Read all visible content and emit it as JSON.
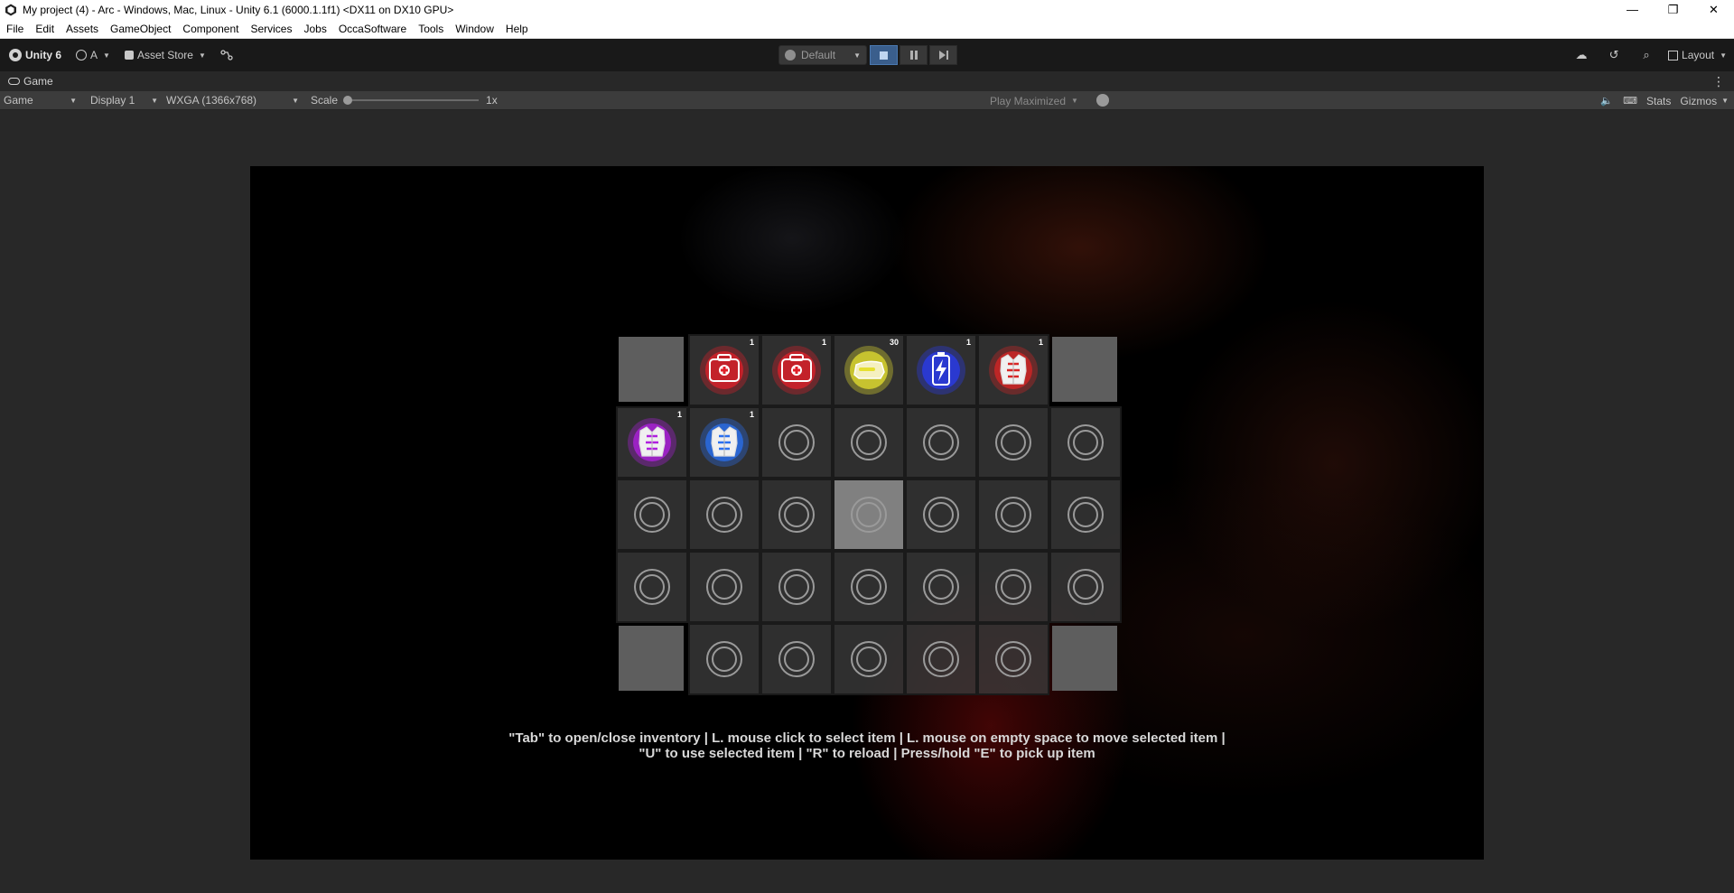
{
  "window": {
    "title": "My project (4) - Arc - Windows, Mac, Linux - Unity 6.1 (6000.1.1f1) <DX11 on DX10 GPU>",
    "minimize": "—",
    "maximize": "❐",
    "close": "✕"
  },
  "menu": [
    "File",
    "Edit",
    "Assets",
    "GameObject",
    "Component",
    "Services",
    "Jobs",
    "OccaSoftware",
    "Tools",
    "Window",
    "Help"
  ],
  "toolbar": {
    "unity_label": "Unity 6",
    "account_label": "A",
    "asset_store_label": "Asset Store",
    "layers_label": "Default",
    "layout_label": "Layout",
    "play_active_color": "#3a5e8c"
  },
  "game_tab": {
    "label": "Game",
    "menu": "⋮"
  },
  "game_bar": {
    "mode": "Game",
    "display": "Display 1",
    "resolution": "WXGA (1366x768)",
    "scale_label": "Scale",
    "scale_value": "1x",
    "scale_fraction": 0.0,
    "play_mode": "Play Maximized",
    "stats": "Stats",
    "gizmos": "Gizmos"
  },
  "inventory": {
    "slots": [
      {
        "kind": "corner"
      },
      {
        "kind": "item",
        "icon": "medkit-icon",
        "qty": "1",
        "color": "#e0202a"
      },
      {
        "kind": "item",
        "icon": "medkit-icon",
        "qty": "1",
        "color": "#e0202a"
      },
      {
        "kind": "item",
        "icon": "ammo-icon",
        "qty": "30",
        "color": "#e6e030"
      },
      {
        "kind": "item",
        "icon": "battery-icon",
        "qty": "1",
        "color": "#2a3cf0"
      },
      {
        "kind": "item",
        "icon": "armor-vest-icon",
        "qty": "1",
        "color": "#d82626"
      },
      {
        "kind": "corner"
      },
      {
        "kind": "item",
        "icon": "armor-vest-icon",
        "qty": "1",
        "color": "#b020e0"
      },
      {
        "kind": "item",
        "icon": "armor-vest-icon",
        "qty": "1",
        "color": "#2a70f0"
      },
      {
        "kind": "empty"
      },
      {
        "kind": "empty"
      },
      {
        "kind": "empty"
      },
      {
        "kind": "empty"
      },
      {
        "kind": "empty"
      },
      {
        "kind": "empty"
      },
      {
        "kind": "empty"
      },
      {
        "kind": "empty"
      },
      {
        "kind": "empty",
        "selected": true
      },
      {
        "kind": "empty"
      },
      {
        "kind": "empty"
      },
      {
        "kind": "empty"
      },
      {
        "kind": "empty"
      },
      {
        "kind": "empty"
      },
      {
        "kind": "empty"
      },
      {
        "kind": "empty"
      },
      {
        "kind": "empty"
      },
      {
        "kind": "empty"
      },
      {
        "kind": "empty"
      },
      {
        "kind": "corner"
      },
      {
        "kind": "empty"
      },
      {
        "kind": "empty"
      },
      {
        "kind": "empty"
      },
      {
        "kind": "empty"
      },
      {
        "kind": "empty"
      },
      {
        "kind": "corner"
      }
    ]
  },
  "hint": {
    "line1": "\"Tab\" to open/close inventory | L. mouse click to select item | L. mouse on empty space to move selected item |",
    "line2": "\"U\" to use selected item | \"R\" to reload | Press/hold \"E\" to pick up item"
  }
}
